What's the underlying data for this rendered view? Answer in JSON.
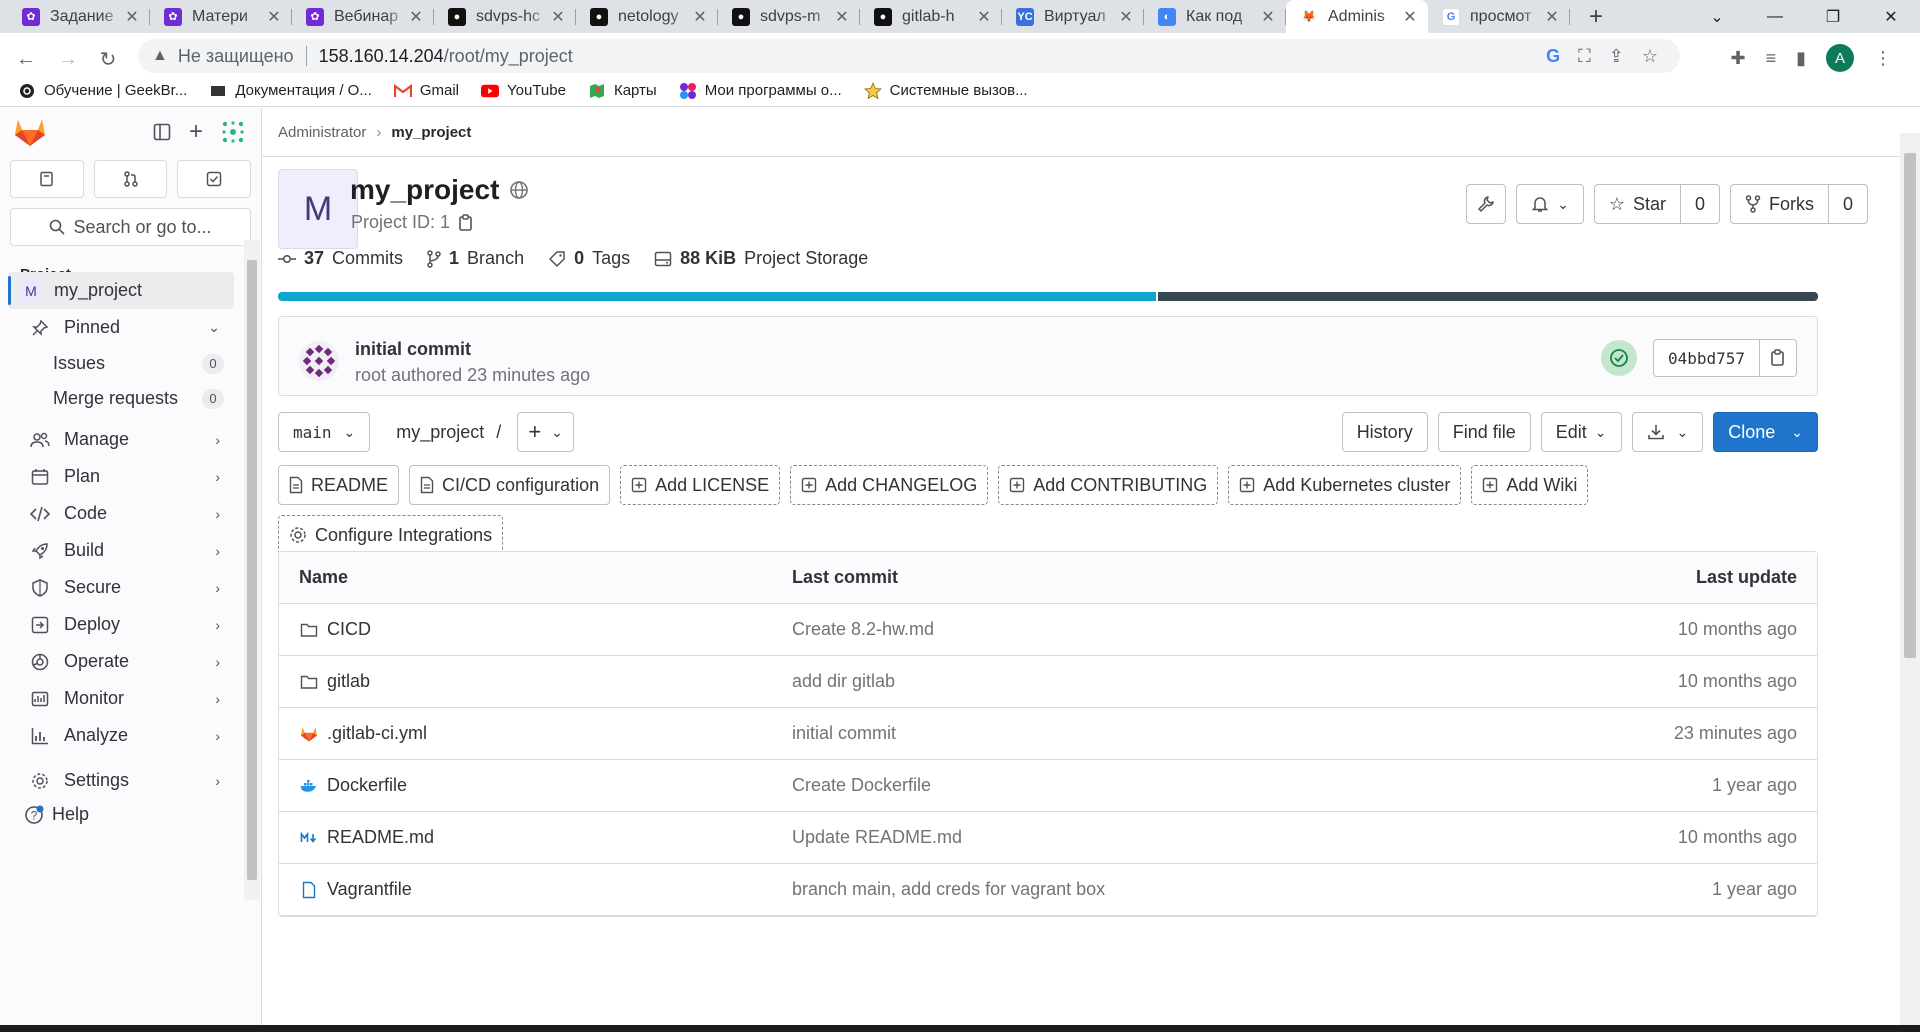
{
  "browser": {
    "tabs": [
      {
        "title": "Задание",
        "fav": "#6f2cd6",
        "fav_char": "✿"
      },
      {
        "title": "Матери",
        "fav": "#6f2cd6",
        "fav_char": "✿"
      },
      {
        "title": "Вебинар",
        "fav": "#6f2cd6",
        "fav_char": "✿"
      },
      {
        "title": "sdvps-hc",
        "fav": "#111111",
        "fav_char": "●"
      },
      {
        "title": "netology",
        "fav": "#111111",
        "fav_char": "●"
      },
      {
        "title": "sdvps-m",
        "fav": "#111111",
        "fav_char": "●"
      },
      {
        "title": "gitlab-h",
        "fav": "#111111",
        "fav_char": "●"
      },
      {
        "title": "Виртуал",
        "fav": "#3b6fe0",
        "fav_char": "YC"
      },
      {
        "title": "Как под",
        "fav": "#4285f4",
        "fav_char": "◐"
      },
      {
        "title": "Adminis",
        "fav": "#e24329",
        "fav_char": "🦊",
        "active": true
      },
      {
        "title": "просмот",
        "fav": "#ffffff",
        "fav_char": "G"
      }
    ],
    "address": {
      "insecure_label": "Не защищено",
      "host": "158.160.14.204",
      "path": "/root/my_project"
    },
    "bookmarks": [
      {
        "label": "Обучение | GeekBr...",
        "icon": "geekbrains-icon"
      },
      {
        "label": "Документация / О...",
        "icon": "docs-icon"
      },
      {
        "label": "Gmail",
        "icon": "gmail-icon"
      },
      {
        "label": "YouTube",
        "icon": "youtube-icon"
      },
      {
        "label": "Карты",
        "icon": "maps-icon"
      },
      {
        "label": "Мои программы о...",
        "icon": "programs-icon"
      },
      {
        "label": "Системные вызов...",
        "icon": "star-icon"
      }
    ],
    "profile_initial": "A"
  },
  "sidebar": {
    "search_placeholder": "Search or go to...",
    "section_label": "Project",
    "project_initial": "M",
    "project_name": "my_project",
    "pinned_label": "Pinned",
    "pinned_items": [
      {
        "label": "Issues",
        "count": "0"
      },
      {
        "label": "Merge requests",
        "count": "0"
      }
    ],
    "nav": [
      {
        "label": "Manage",
        "icon": "users-icon"
      },
      {
        "label": "Plan",
        "icon": "calendar-icon"
      },
      {
        "label": "Code",
        "icon": "code-icon"
      },
      {
        "label": "Build",
        "icon": "rocket-icon"
      },
      {
        "label": "Secure",
        "icon": "shield-icon"
      },
      {
        "label": "Deploy",
        "icon": "deploy-icon"
      },
      {
        "label": "Operate",
        "icon": "operate-icon"
      },
      {
        "label": "Monitor",
        "icon": "monitor-icon"
      },
      {
        "label": "Analyze",
        "icon": "chart-icon"
      }
    ],
    "settings_label": "Settings",
    "help_label": "Help"
  },
  "breadcrumb": {
    "parent": "Administrator",
    "current": "my_project"
  },
  "project": {
    "initial": "M",
    "name": "my_project",
    "id_label": "Project ID: 1",
    "star_label": "Star",
    "star_count": "0",
    "forks_label": "Forks",
    "forks_count": "0"
  },
  "stats": {
    "commits_num": "37",
    "commits_label": "Commits",
    "branch_num": "1",
    "branch_label": "Branch",
    "tags_num": "0",
    "tags_label": "Tags",
    "storage_num": "88 KiB",
    "storage_label": "Project Storage"
  },
  "languages": [
    {
      "share": 57.1,
      "color": "#0ea5cf"
    },
    {
      "share": 42.9,
      "color": "#37474f"
    }
  ],
  "last_commit": {
    "title": "initial commit",
    "meta": "root authored 23 minutes ago",
    "sha": "04bbd757"
  },
  "repo": {
    "branch": "main",
    "path": "my_project",
    "path_sep": "/",
    "history": "History",
    "find_file": "Find file",
    "edit": "Edit",
    "clone": "Clone"
  },
  "quick_links": [
    {
      "label": "README",
      "icon": "file-icon",
      "dashed": false
    },
    {
      "label": "CI/CD configuration",
      "icon": "file-icon",
      "dashed": false
    },
    {
      "label": "Add LICENSE",
      "icon": "plus-square-icon",
      "dashed": true
    },
    {
      "label": "Add CHANGELOG",
      "icon": "plus-square-icon",
      "dashed": true
    },
    {
      "label": "Add CONTRIBUTING",
      "icon": "plus-square-icon",
      "dashed": true
    },
    {
      "label": "Add Kubernetes cluster",
      "icon": "plus-square-icon",
      "dashed": true
    },
    {
      "label": "Add Wiki",
      "icon": "plus-square-icon",
      "dashed": true
    },
    {
      "label": "Configure Integrations",
      "icon": "gear-icon",
      "dashed": true
    }
  ],
  "files": {
    "headers": {
      "name": "Name",
      "commit": "Last commit",
      "date": "Last update"
    },
    "rows": [
      {
        "name": "CICD",
        "type": "folder",
        "commit": "Create 8.2-hw.md",
        "date": "10 months ago"
      },
      {
        "name": "gitlab",
        "type": "folder",
        "commit": "add dir gitlab",
        "date": "10 months ago"
      },
      {
        "name": ".gitlab-ci.yml",
        "type": "gitlab",
        "commit": "initial commit",
        "date": "23 minutes ago"
      },
      {
        "name": "Dockerfile",
        "type": "docker",
        "commit": "Create Dockerfile",
        "date": "1 year ago"
      },
      {
        "name": "README.md",
        "type": "markdown",
        "commit": "Update README.md",
        "date": "10 months ago"
      },
      {
        "name": "Vagrantfile",
        "type": "file",
        "commit": "branch main, add creds for vagrant box",
        "date": "1 year ago"
      }
    ]
  }
}
